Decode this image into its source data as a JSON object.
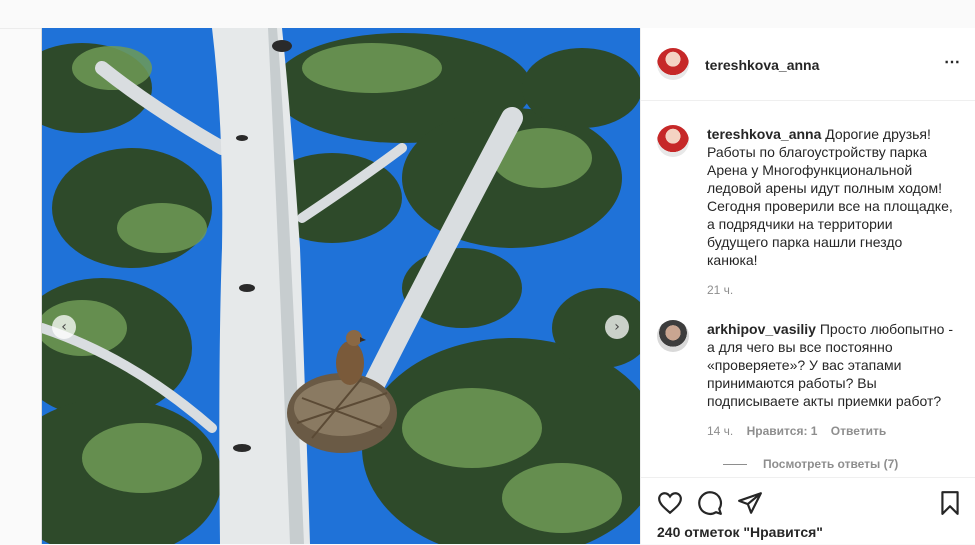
{
  "post": {
    "author": "tereshkova_anna",
    "caption": "Дорогие друзья! Работы по благоустройству парка Арена у Многофункциональной ледовой арены идут полным ходом! Сегодня проверили все на площадке, а подрядчики на территории будущего парка нашли гнездо канюка!",
    "caption_time": "21 ч.",
    "more_icon": "⋯"
  },
  "comments": [
    {
      "username": "arkhipov_vasiliy",
      "text": "Просто любопытно - а для чего вы все постоянно «проверяете»? У вас этапами принимаются работы? Вы подписываете акты приемки работ?",
      "time": "14 ч.",
      "likes": "Нравится: 1",
      "reply_label": "Ответить",
      "view_replies": "Посмотреть ответы (7)"
    }
  ],
  "actions": {
    "icons": [
      "heart-icon",
      "comment-icon",
      "share-icon",
      "bookmark-icon"
    ],
    "likes_text": "240 отметок \"Нравится\""
  },
  "carousel": {
    "prev_glyph": "‹",
    "next_glyph": "›"
  },
  "colors": {
    "sky": "#1e6fd6",
    "text": "#262626",
    "muted": "#8e8e8e"
  }
}
